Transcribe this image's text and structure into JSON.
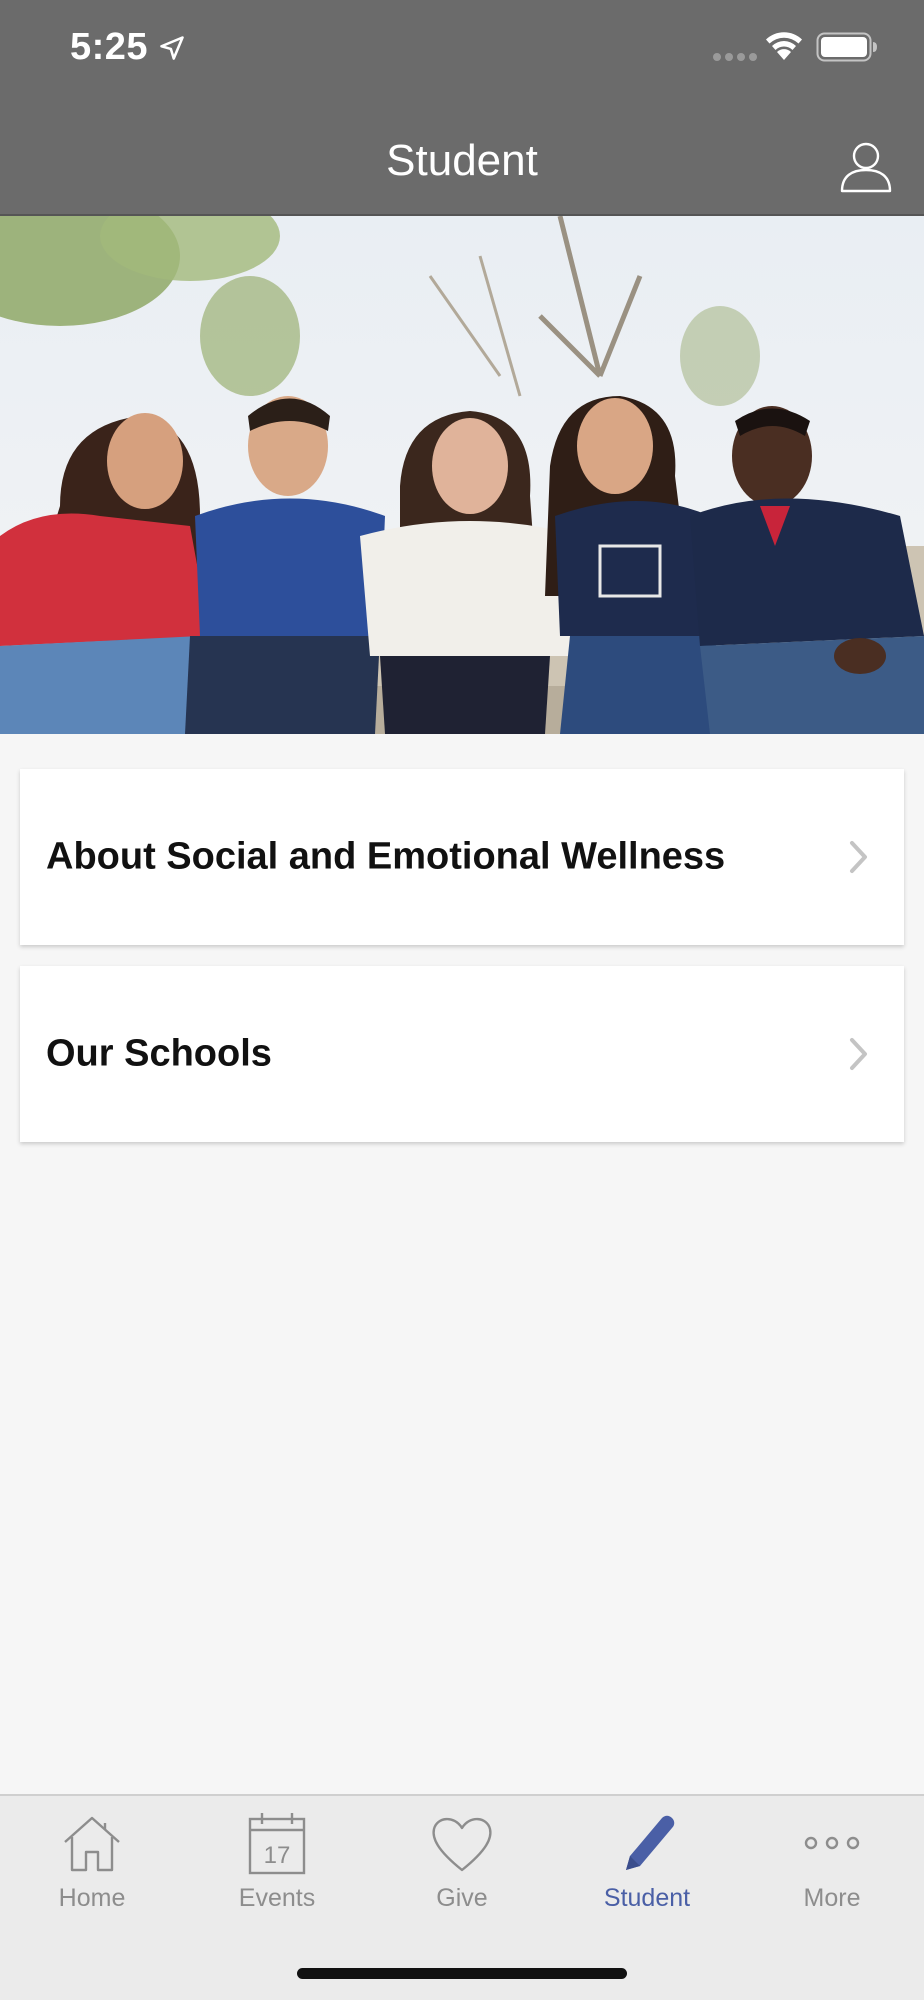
{
  "status_bar": {
    "time": "5:25",
    "icons": [
      "location-arrow-icon",
      "cellular-signal-icon",
      "wifi-icon",
      "battery-icon"
    ]
  },
  "header": {
    "title": "Student",
    "profile_icon": "user-icon",
    "background_color": "#6b6b6b"
  },
  "hero": {
    "image_name": "students-group-photo"
  },
  "list": {
    "items": [
      {
        "label": "About Social and Emotional Wellness",
        "icon": "chevron-right-icon"
      },
      {
        "label": "Our Schools",
        "icon": "chevron-right-icon"
      }
    ]
  },
  "tab_bar": {
    "active_color": "#4a5fa6",
    "inactive_color": "#8d8d8d",
    "tabs": [
      {
        "label": "Home",
        "icon": "home-icon",
        "active": false
      },
      {
        "label": "Events",
        "icon": "calendar-icon",
        "active": false,
        "calendar_day": "17"
      },
      {
        "label": "Give",
        "icon": "heart-icon",
        "active": false
      },
      {
        "label": "Student",
        "icon": "pencil-icon",
        "active": true
      },
      {
        "label": "More",
        "icon": "more-icon",
        "active": false
      }
    ]
  }
}
